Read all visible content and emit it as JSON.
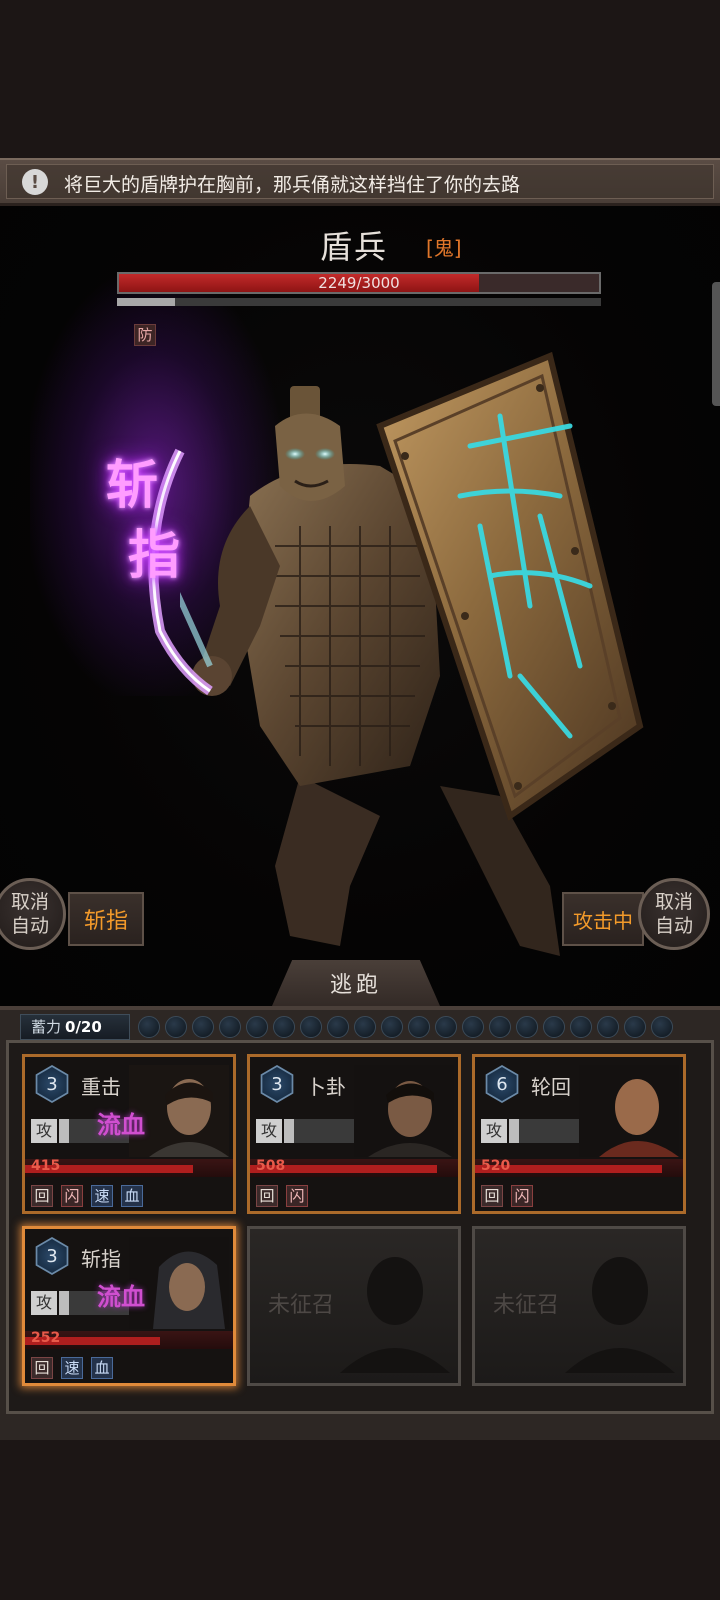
{
  "message": {
    "text": "将巨大的盾牌护在胸前，那兵俑就这样挡住了你的去路"
  },
  "enemy": {
    "name": "盾兵",
    "tag": "[鬼]",
    "hp_text": "2249/3000",
    "hp_current": 2249,
    "hp_max": 3000,
    "shield_fraction": 0.12,
    "buff": "防"
  },
  "skill_effect": {
    "chars": [
      "斩",
      "指"
    ]
  },
  "controls": {
    "left_auto": "取消\n自动",
    "left_skill": "斩指",
    "right_status": "攻击中",
    "right_auto": "取消\n自动",
    "flee": "逃跑"
  },
  "energy": {
    "label": "蓄力",
    "value": "0/20",
    "pips": 20
  },
  "cards": [
    {
      "level": "3",
      "skill": "重击",
      "type": "攻",
      "status_fx": "流血",
      "hp": "415",
      "hp_fraction": 0.9,
      "tags": [
        "回",
        "闪",
        "速",
        "血"
      ]
    },
    {
      "level": "3",
      "skill": "卜卦",
      "type": "攻",
      "status_fx": "",
      "hp": "508",
      "hp_fraction": 1.0,
      "tags": [
        "回",
        "闪"
      ]
    },
    {
      "level": "6",
      "skill": "轮回",
      "type": "攻",
      "status_fx": "",
      "hp": "520",
      "hp_fraction": 1.0,
      "tags": [
        "回",
        "闪"
      ]
    },
    {
      "level": "3",
      "skill": "斩指",
      "type": "攻",
      "status_fx": "流血",
      "hp": "252",
      "hp_fraction": 0.72,
      "tags": [
        "回",
        "速",
        "血"
      ]
    }
  ],
  "empty_slots": [
    {
      "label": "未征召"
    },
    {
      "label": "未征召"
    }
  ],
  "colors": {
    "accent": "#f39a2a",
    "hp_red": "#b01e1e",
    "card_border": "#ab6a2a",
    "purple_fx": "#d040ff"
  },
  "icons": {
    "info": "info-icon",
    "level": "hexagon-badge-icon"
  }
}
